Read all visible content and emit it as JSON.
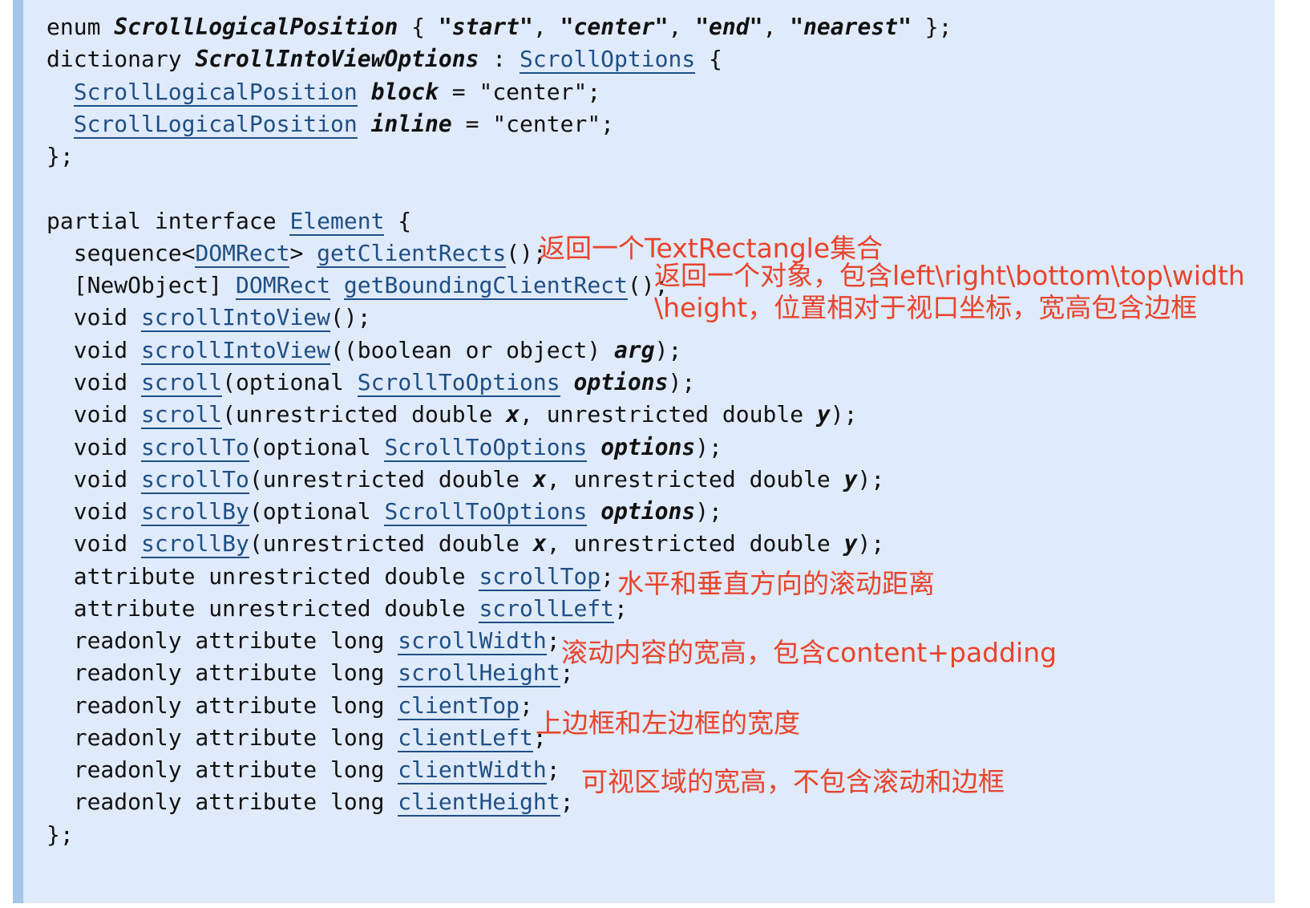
{
  "code": {
    "lines": [
      [
        {
          "t": "enum "
        },
        {
          "t": "ScrollLogicalPosition",
          "s": "bi"
        },
        {
          "t": " { "
        },
        {
          "t": "\"start\"",
          "s": "bi"
        },
        {
          "t": ", "
        },
        {
          "t": "\"center\"",
          "s": "bi"
        },
        {
          "t": ", "
        },
        {
          "t": "\"end\"",
          "s": "bi"
        },
        {
          "t": ", "
        },
        {
          "t": "\"nearest\"",
          "s": "bi"
        },
        {
          "t": " };"
        }
      ],
      [
        {
          "t": "dictionary "
        },
        {
          "t": "ScrollIntoViewOptions",
          "s": "bi"
        },
        {
          "t": " : "
        },
        {
          "t": "ScrollOptions",
          "s": "link"
        },
        {
          "t": " {"
        }
      ],
      [
        {
          "t": "  "
        },
        {
          "t": "ScrollLogicalPosition",
          "s": "link"
        },
        {
          "t": " "
        },
        {
          "t": "block",
          "s": "bi"
        },
        {
          "t": " = \"center\";"
        }
      ],
      [
        {
          "t": "  "
        },
        {
          "t": "ScrollLogicalPosition",
          "s": "link"
        },
        {
          "t": " "
        },
        {
          "t": "inline",
          "s": "bi"
        },
        {
          "t": " = \"center\";"
        }
      ],
      [
        {
          "t": "};"
        }
      ],
      [],
      [
        {
          "t": "partial interface "
        },
        {
          "t": "Element",
          "s": "link"
        },
        {
          "t": " {"
        }
      ],
      [
        {
          "t": "  sequence<"
        },
        {
          "t": "DOMRect",
          "s": "link"
        },
        {
          "t": "> "
        },
        {
          "t": "getClientRects",
          "s": "link"
        },
        {
          "t": "();"
        }
      ],
      [
        {
          "t": "  [NewObject] "
        },
        {
          "t": "DOMRect",
          "s": "link"
        },
        {
          "t": " "
        },
        {
          "t": "getBoundingClientRect",
          "s": "link"
        },
        {
          "t": "();"
        }
      ],
      [
        {
          "t": "  void "
        },
        {
          "t": "scrollIntoView",
          "s": "link"
        },
        {
          "t": "();"
        }
      ],
      [
        {
          "t": "  void "
        },
        {
          "t": "scrollIntoView",
          "s": "link"
        },
        {
          "t": "((boolean or object) "
        },
        {
          "t": "arg",
          "s": "bi"
        },
        {
          "t": ");"
        }
      ],
      [
        {
          "t": "  void "
        },
        {
          "t": "scroll",
          "s": "link"
        },
        {
          "t": "(optional "
        },
        {
          "t": "ScrollToOptions",
          "s": "link"
        },
        {
          "t": " "
        },
        {
          "t": "options",
          "s": "bi"
        },
        {
          "t": ");"
        }
      ],
      [
        {
          "t": "  void "
        },
        {
          "t": "scroll",
          "s": "link"
        },
        {
          "t": "(unrestricted double "
        },
        {
          "t": "x",
          "s": "bi"
        },
        {
          "t": ", unrestricted double "
        },
        {
          "t": "y",
          "s": "bi"
        },
        {
          "t": ");"
        }
      ],
      [
        {
          "t": "  void "
        },
        {
          "t": "scrollTo",
          "s": "link"
        },
        {
          "t": "(optional "
        },
        {
          "t": "ScrollToOptions",
          "s": "link"
        },
        {
          "t": " "
        },
        {
          "t": "options",
          "s": "bi"
        },
        {
          "t": ");"
        }
      ],
      [
        {
          "t": "  void "
        },
        {
          "t": "scrollTo",
          "s": "link"
        },
        {
          "t": "(unrestricted double "
        },
        {
          "t": "x",
          "s": "bi"
        },
        {
          "t": ", unrestricted double "
        },
        {
          "t": "y",
          "s": "bi"
        },
        {
          "t": ");"
        }
      ],
      [
        {
          "t": "  void "
        },
        {
          "t": "scrollBy",
          "s": "link"
        },
        {
          "t": "(optional "
        },
        {
          "t": "ScrollToOptions",
          "s": "link"
        },
        {
          "t": " "
        },
        {
          "t": "options",
          "s": "bi"
        },
        {
          "t": ");"
        }
      ],
      [
        {
          "t": "  void "
        },
        {
          "t": "scrollBy",
          "s": "link"
        },
        {
          "t": "(unrestricted double "
        },
        {
          "t": "x",
          "s": "bi"
        },
        {
          "t": ", unrestricted double "
        },
        {
          "t": "y",
          "s": "bi"
        },
        {
          "t": ");"
        }
      ],
      [
        {
          "t": "  attribute unrestricted double "
        },
        {
          "t": "scrollTop",
          "s": "link"
        },
        {
          "t": ";"
        }
      ],
      [
        {
          "t": "  attribute unrestricted double "
        },
        {
          "t": "scrollLeft",
          "s": "link"
        },
        {
          "t": ";"
        }
      ],
      [
        {
          "t": "  readonly attribute long "
        },
        {
          "t": "scrollWidth",
          "s": "link"
        },
        {
          "t": ";"
        }
      ],
      [
        {
          "t": "  readonly attribute long "
        },
        {
          "t": "scrollHeight",
          "s": "link"
        },
        {
          "t": ";"
        }
      ],
      [
        {
          "t": "  readonly attribute long "
        },
        {
          "t": "clientTop",
          "s": "link"
        },
        {
          "t": ";"
        }
      ],
      [
        {
          "t": "  readonly attribute long "
        },
        {
          "t": "clientLeft",
          "s": "link"
        },
        {
          "t": ";"
        }
      ],
      [
        {
          "t": "  readonly attribute long "
        },
        {
          "t": "clientWidth",
          "s": "link"
        },
        {
          "t": ";"
        }
      ],
      [
        {
          "t": "  readonly attribute long "
        },
        {
          "t": "clientHeight",
          "s": "link"
        },
        {
          "t": ";"
        }
      ],
      [
        {
          "t": "};"
        }
      ]
    ]
  },
  "annotations": {
    "get_client_rects": "返回一个TextRectangle集合",
    "bounding_rect_line1": "返回一个对象，包含left\\right\\bottom\\top\\width",
    "bounding_rect_line2": "\\height，位置相对于视口坐标，宽高包含边框",
    "scroll_offsets": "水平和垂直方向的滚动距离",
    "scroll_size": "滚动内容的宽高，包含content+padding",
    "client_border": "上边框和左边框的宽度",
    "client_size": "可视区域的宽高，不包含滚动和边框"
  },
  "colors": {
    "panel_background": "#dfeafb",
    "panel_stripe": "#a2c6ec",
    "link": "#1f4f84",
    "annotation": "#e8442c"
  }
}
